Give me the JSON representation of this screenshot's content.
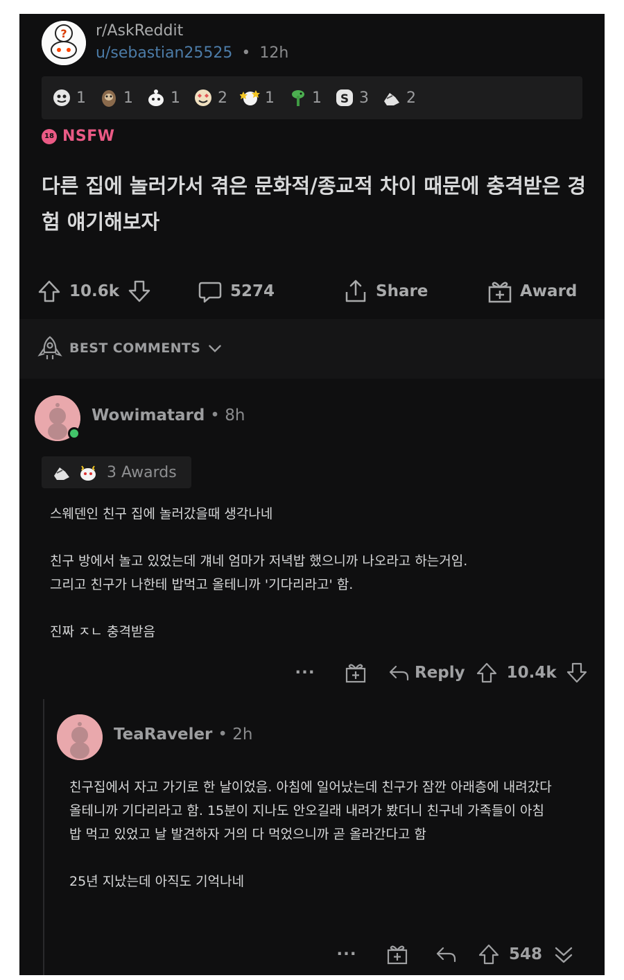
{
  "post": {
    "subreddit": "r/AskReddit",
    "author": "u/sebastian25525",
    "separator": "•",
    "age": "12h",
    "awards": [
      {
        "icon": "silver-award-icon",
        "count": "1"
      },
      {
        "icon": "sloth-award-icon",
        "count": "1"
      },
      {
        "icon": "wholesome-award-icon",
        "count": "1"
      },
      {
        "icon": "heart-eyes-award-icon",
        "count": "2"
      },
      {
        "icon": "starstruck-award-icon",
        "count": "1"
      },
      {
        "icon": "plant-award-icon",
        "count": "1"
      },
      {
        "icon": "s-coin-award-icon",
        "count": "3"
      },
      {
        "icon": "helpful-hand-award-icon",
        "count": "2"
      }
    ],
    "nsfw_badge": "18",
    "nsfw_label": "NSFW",
    "title": "다른 집에 놀러가서 겪은 문화적/종교적 차이 때문에 충격받은 경험 얘기해보자",
    "votes": "10.6k",
    "comments": "5274",
    "share_label": "Share",
    "award_label": "Award"
  },
  "sort": {
    "label": "BEST COMMENTS"
  },
  "comments": [
    {
      "author": "Wowimatard",
      "separator": "•",
      "age": "8h",
      "awards_label": "3 Awards",
      "body": [
        "스웨덴인 친구 집에 놀러갔을때 생각나네",
        "친구 방에서 놀고 있었는데 걔네 엄마가 저녁밥 했으니까 나오라고 하는거임.",
        "그리고 친구가 나한테 밥먹고 올테니까 '기다리라고' 함.",
        "진짜 ㅈㄴ 충격받음"
      ],
      "more": "···",
      "reply_label": "Reply",
      "votes": "10.4k"
    },
    {
      "author": "TeaRaveler",
      "separator": "•",
      "age": "2h",
      "body": [
        "친구집에서 자고 가기로 한 날이었음. 아침에 일어났는데 친구가 잠깐 아래층에 내려갔다",
        "올테니까 기다리라고 함. 15분이 지나도 안오길래 내려가 봤더니 친구네 가족들이 아침",
        "밥 먹고 있었고 날 발견하자 거의 다 먹었으니까 곧 올라간다고 함",
        "25년 지났는데 아직도 기억나네"
      ],
      "more": "···",
      "votes": "548"
    }
  ],
  "colors": {
    "background": "#0f0f10",
    "text": "#d7d8d9",
    "muted": "#9d9ea0",
    "link": "#4c7ca8",
    "nsfw": "#ea5a85",
    "online": "#42c46a"
  }
}
